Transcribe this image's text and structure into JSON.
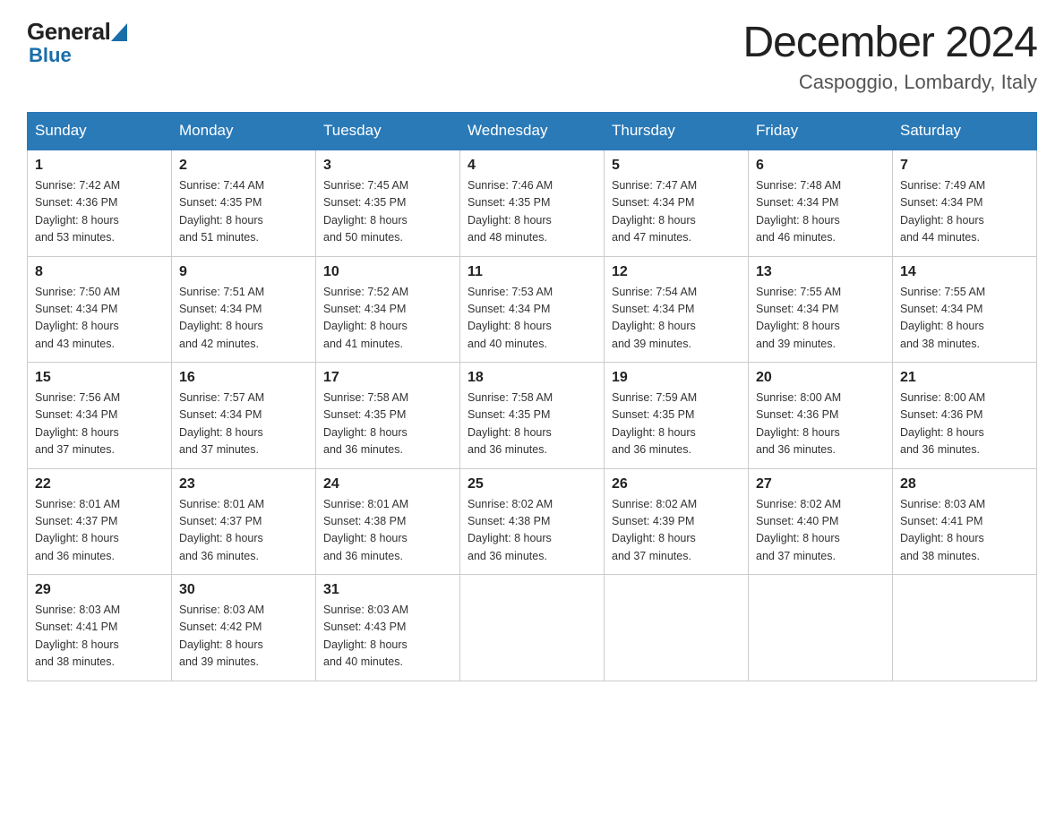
{
  "header": {
    "logo_general": "General",
    "logo_blue": "Blue",
    "month_title": "December 2024",
    "location": "Caspoggio, Lombardy, Italy"
  },
  "days_of_week": [
    "Sunday",
    "Monday",
    "Tuesday",
    "Wednesday",
    "Thursday",
    "Friday",
    "Saturday"
  ],
  "weeks": [
    [
      {
        "day": "1",
        "sunrise": "7:42 AM",
        "sunset": "4:36 PM",
        "daylight": "8 hours and 53 minutes."
      },
      {
        "day": "2",
        "sunrise": "7:44 AM",
        "sunset": "4:35 PM",
        "daylight": "8 hours and 51 minutes."
      },
      {
        "day": "3",
        "sunrise": "7:45 AM",
        "sunset": "4:35 PM",
        "daylight": "8 hours and 50 minutes."
      },
      {
        "day": "4",
        "sunrise": "7:46 AM",
        "sunset": "4:35 PM",
        "daylight": "8 hours and 48 minutes."
      },
      {
        "day": "5",
        "sunrise": "7:47 AM",
        "sunset": "4:34 PM",
        "daylight": "8 hours and 47 minutes."
      },
      {
        "day": "6",
        "sunrise": "7:48 AM",
        "sunset": "4:34 PM",
        "daylight": "8 hours and 46 minutes."
      },
      {
        "day": "7",
        "sunrise": "7:49 AM",
        "sunset": "4:34 PM",
        "daylight": "8 hours and 44 minutes."
      }
    ],
    [
      {
        "day": "8",
        "sunrise": "7:50 AM",
        "sunset": "4:34 PM",
        "daylight": "8 hours and 43 minutes."
      },
      {
        "day": "9",
        "sunrise": "7:51 AM",
        "sunset": "4:34 PM",
        "daylight": "8 hours and 42 minutes."
      },
      {
        "day": "10",
        "sunrise": "7:52 AM",
        "sunset": "4:34 PM",
        "daylight": "8 hours and 41 minutes."
      },
      {
        "day": "11",
        "sunrise": "7:53 AM",
        "sunset": "4:34 PM",
        "daylight": "8 hours and 40 minutes."
      },
      {
        "day": "12",
        "sunrise": "7:54 AM",
        "sunset": "4:34 PM",
        "daylight": "8 hours and 39 minutes."
      },
      {
        "day": "13",
        "sunrise": "7:55 AM",
        "sunset": "4:34 PM",
        "daylight": "8 hours and 39 minutes."
      },
      {
        "day": "14",
        "sunrise": "7:55 AM",
        "sunset": "4:34 PM",
        "daylight": "8 hours and 38 minutes."
      }
    ],
    [
      {
        "day": "15",
        "sunrise": "7:56 AM",
        "sunset": "4:34 PM",
        "daylight": "8 hours and 37 minutes."
      },
      {
        "day": "16",
        "sunrise": "7:57 AM",
        "sunset": "4:34 PM",
        "daylight": "8 hours and 37 minutes."
      },
      {
        "day": "17",
        "sunrise": "7:58 AM",
        "sunset": "4:35 PM",
        "daylight": "8 hours and 36 minutes."
      },
      {
        "day": "18",
        "sunrise": "7:58 AM",
        "sunset": "4:35 PM",
        "daylight": "8 hours and 36 minutes."
      },
      {
        "day": "19",
        "sunrise": "7:59 AM",
        "sunset": "4:35 PM",
        "daylight": "8 hours and 36 minutes."
      },
      {
        "day": "20",
        "sunrise": "8:00 AM",
        "sunset": "4:36 PM",
        "daylight": "8 hours and 36 minutes."
      },
      {
        "day": "21",
        "sunrise": "8:00 AM",
        "sunset": "4:36 PM",
        "daylight": "8 hours and 36 minutes."
      }
    ],
    [
      {
        "day": "22",
        "sunrise": "8:01 AM",
        "sunset": "4:37 PM",
        "daylight": "8 hours and 36 minutes."
      },
      {
        "day": "23",
        "sunrise": "8:01 AM",
        "sunset": "4:37 PM",
        "daylight": "8 hours and 36 minutes."
      },
      {
        "day": "24",
        "sunrise": "8:01 AM",
        "sunset": "4:38 PM",
        "daylight": "8 hours and 36 minutes."
      },
      {
        "day": "25",
        "sunrise": "8:02 AM",
        "sunset": "4:38 PM",
        "daylight": "8 hours and 36 minutes."
      },
      {
        "day": "26",
        "sunrise": "8:02 AM",
        "sunset": "4:39 PM",
        "daylight": "8 hours and 37 minutes."
      },
      {
        "day": "27",
        "sunrise": "8:02 AM",
        "sunset": "4:40 PM",
        "daylight": "8 hours and 37 minutes."
      },
      {
        "day": "28",
        "sunrise": "8:03 AM",
        "sunset": "4:41 PM",
        "daylight": "8 hours and 38 minutes."
      }
    ],
    [
      {
        "day": "29",
        "sunrise": "8:03 AM",
        "sunset": "4:41 PM",
        "daylight": "8 hours and 38 minutes."
      },
      {
        "day": "30",
        "sunrise": "8:03 AM",
        "sunset": "4:42 PM",
        "daylight": "8 hours and 39 minutes."
      },
      {
        "day": "31",
        "sunrise": "8:03 AM",
        "sunset": "4:43 PM",
        "daylight": "8 hours and 40 minutes."
      },
      null,
      null,
      null,
      null
    ]
  ],
  "labels": {
    "sunrise": "Sunrise:",
    "sunset": "Sunset:",
    "daylight": "Daylight:"
  }
}
